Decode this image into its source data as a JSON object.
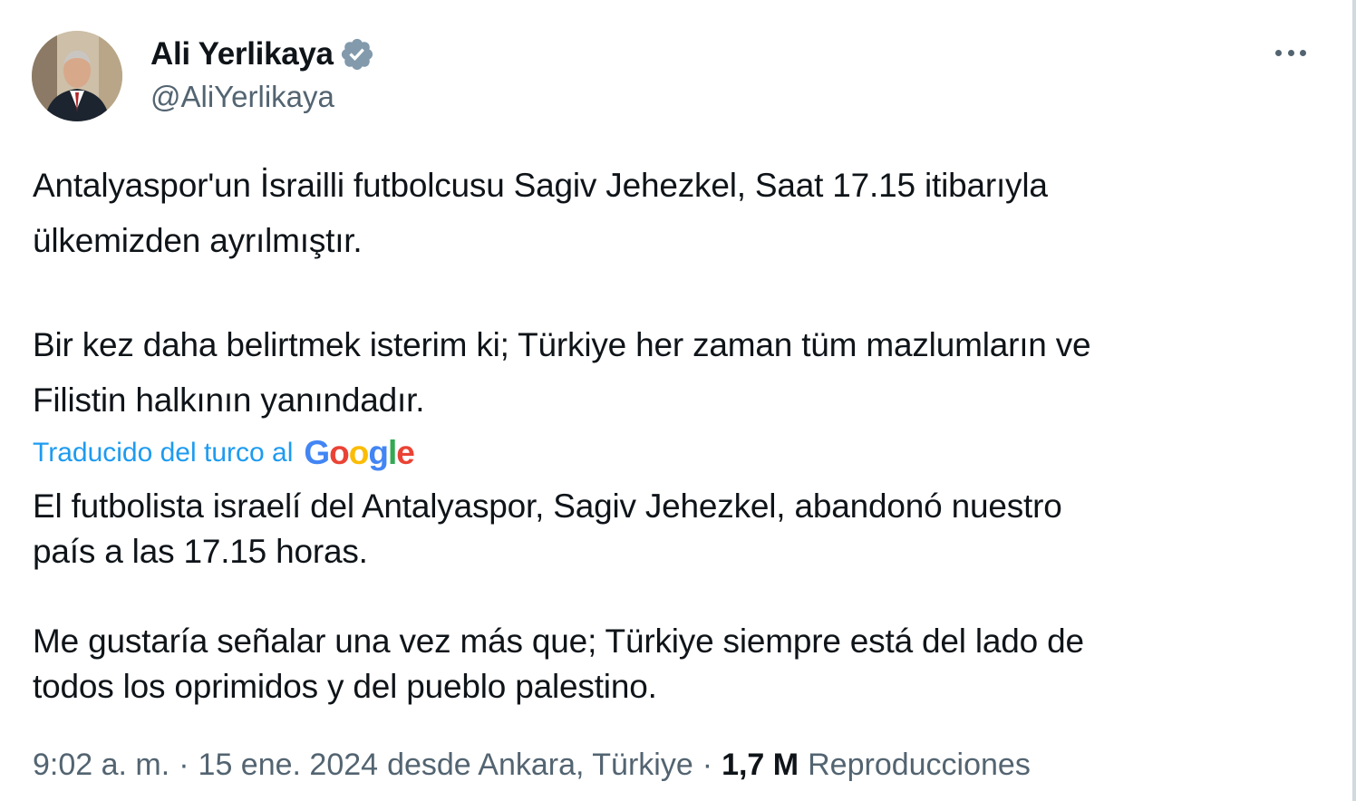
{
  "author": {
    "display_name": "Ali Yerlikaya",
    "handle": "@AliYerlikaya",
    "verified_icon": "verified-badge-icon",
    "verified_color": "#829aab"
  },
  "more_icon": "more-horizontal-icon",
  "tweet": {
    "original": [
      [
        "Antalyaspor'un İsrailli futbolcusu Sagiv Jehezkel, Saat 17.15 itibarıyla",
        "ülkemizden ayrılmıştır."
      ],
      [
        "Bir kez daha belirtmek isterim ki; Türkiye her zaman tüm mazlumların ve",
        "Filistin halkının yanındadır."
      ]
    ],
    "translation_label": "Traducido del turco al",
    "translation_provider": "Google",
    "translated": [
      [
        "El futbolista israelí del Antalyaspor, Sagiv Jehezkel, abandonó nuestro",
        "país a las 17.15 horas."
      ],
      [
        "Me gustaría señalar una vez más que; Türkiye siempre está del lado de",
        "todos los oprimidos y del pueblo palestino."
      ]
    ]
  },
  "meta": {
    "time": "9:02 a. m.",
    "separator": "·",
    "date": "15 ene. 2024",
    "location": "desde Ankara, Türkiye",
    "views_count": "1,7 M",
    "views_label": "Reproducciones"
  },
  "colors": {
    "link": "#1d9bf0",
    "text": "#0f1419",
    "secondary": "#536471",
    "google_blue": "#4285f4",
    "google_red": "#ea4335",
    "google_yellow": "#fbbc05",
    "google_green": "#34a853"
  }
}
